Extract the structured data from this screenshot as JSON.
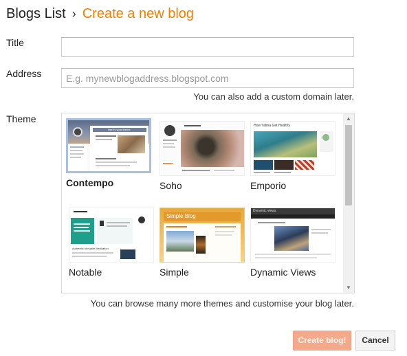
{
  "breadcrumb": {
    "root": "Blogs List",
    "separator": "›",
    "current": "Create a new blog"
  },
  "form": {
    "title_label": "Title",
    "title_value": "",
    "address_label": "Address",
    "address_placeholder": "E.g. mynewblogaddress.blogspot.com",
    "address_hint": "You can also add a custom domain later.",
    "theme_label": "Theme"
  },
  "themes": [
    {
      "name": "Contempo",
      "selected": true,
      "caption": "Here's your theme"
    },
    {
      "name": "Soho",
      "selected": false
    },
    {
      "name": "Emporio",
      "selected": false,
      "caption": "How Yalma Get Healthy"
    },
    {
      "name": "Notable",
      "selected": false,
      "caption": "Authentic Versatile Meditation"
    },
    {
      "name": "Simple",
      "selected": false,
      "caption": "Simple Blog"
    },
    {
      "name": "Dynamic Views",
      "selected": false,
      "caption": "Dynamic views"
    }
  ],
  "browse_hint": "You can browse many more themes and customise your blog later.",
  "buttons": {
    "create": "Create blog!",
    "cancel": "Cancel"
  },
  "colors": {
    "accent": "#f57d00",
    "primary_button": "#f4a98b",
    "selected_border": "#a7bfe0"
  }
}
